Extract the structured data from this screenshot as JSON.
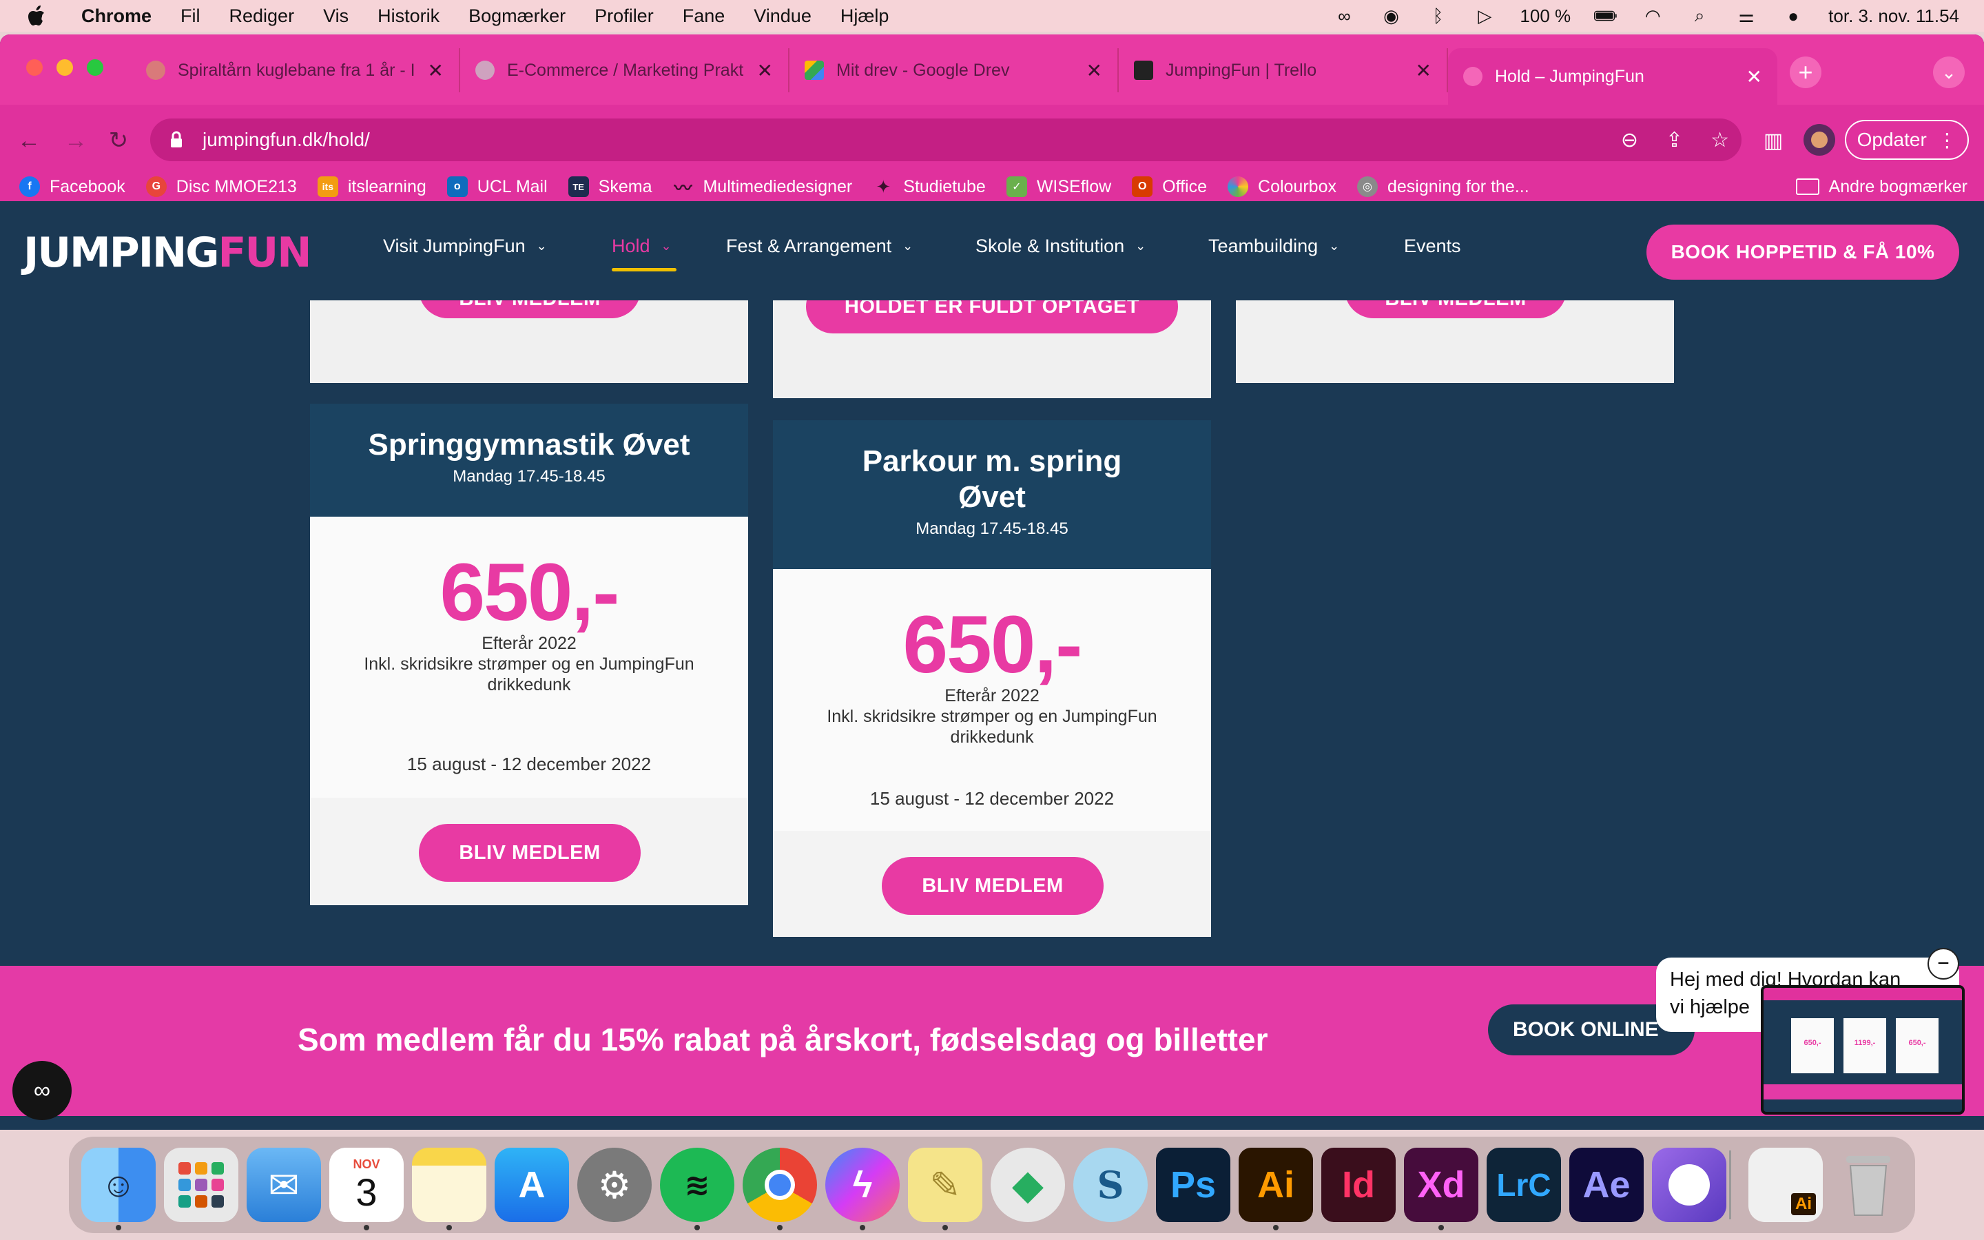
{
  "menubar": {
    "app": "Chrome",
    "items": [
      "Fil",
      "Rediger",
      "Vis",
      "Historik",
      "Bogmærker",
      "Profiler",
      "Fane",
      "Vindue",
      "Hjælp"
    ],
    "battery": "100 %",
    "datetime": "tor. 3. nov.  11.54"
  },
  "tabs": [
    {
      "label": "Spiraltårn kuglebane fra 1 år - I",
      "color": "#d97a7a"
    },
    {
      "label": "E-Commerce / Marketing Prakt",
      "color": "#cfa2bf"
    },
    {
      "label": "Mit drev - Google Drev",
      "color": "#34a853"
    },
    {
      "label": "JumpingFun | Trello",
      "color": "#222222"
    },
    {
      "label": "Hold – JumpingFun",
      "color": "#e83aa3"
    }
  ],
  "toolbar": {
    "url": "jumpingfun.dk/hold/",
    "update_label": "Opdater"
  },
  "bookmarks": [
    {
      "label": "Facebook",
      "icon": "f",
      "color": "#1877f2"
    },
    {
      "label": "Disc MMOE213",
      "icon": "G",
      "color": "#e8453c"
    },
    {
      "label": "itslearning",
      "icon": "its",
      "color": "#f39c12"
    },
    {
      "label": "UCL Mail",
      "icon": "o",
      "color": "#0f6cbd"
    },
    {
      "label": "Skema",
      "icon": "TE",
      "color": "#1d2b4f"
    },
    {
      "label": "Multimediedesigner",
      "icon": "~",
      "color": "#5a1844"
    },
    {
      "label": "Studietube",
      "icon": "✦",
      "color": "#3a1a3a"
    },
    {
      "label": "WISEflow",
      "icon": "✓",
      "color": "#6ab04c"
    },
    {
      "label": "Office",
      "icon": "O",
      "color": "#d83b01"
    },
    {
      "label": "Colourbox",
      "icon": "✿",
      "color": "#e84393"
    },
    {
      "label": "designing for the...",
      "icon": "◎",
      "color": "#8a8a8a"
    }
  ],
  "other_bookmarks": "Andre bogmærker",
  "site": {
    "logo_a": "JUMPING",
    "logo_b": "FUN",
    "nav": [
      "Visit JumpingFun",
      "Hold",
      "Fest & Arrangement",
      "Skole & Institution",
      "Teambuilding",
      "Events"
    ],
    "cta": "BOOK HOPPETID & FÅ 10%"
  },
  "top_row": {
    "left_btn": "BLIV MEDLEM",
    "middle_btn": "HOLDET ER FULDT OPTAGET",
    "right_btn": "BLIV MEDLEM"
  },
  "cards": [
    {
      "title_1": "Springgymnastik Øvet",
      "title_2": "",
      "time": "Mandag 17.45-18.45",
      "price": "650,-",
      "season": "Efterår 2022",
      "incl": "Inkl. skridsikre strømper og en JumpingFun drikkedunk",
      "dates": "15 august - 12 december 2022",
      "button": "BLIV MEDLEM"
    },
    {
      "title_1": "Parkour m. spring",
      "title_2": "Øvet",
      "time": "Mandag 17.45-18.45",
      "price": "650,-",
      "season": "Efterår 2022",
      "incl": "Inkl. skridsikre strømper og en JumpingFun drikkedunk",
      "dates": "15 august - 12 december 2022",
      "button": "BLIV MEDLEM"
    }
  ],
  "promo": {
    "text": "Som medlem får du 15% rabat på årskort, fødselsdag og billetter",
    "button": "BOOK ONLINE"
  },
  "chat": {
    "line1": "Hej med dig! Hvordan kan",
    "line2": "vi hjælpe"
  },
  "thumbnail": {
    "p1": "650,-",
    "p2": "1199,-",
    "p3": "650,-"
  },
  "dock": {
    "calendar_month": "NOV",
    "calendar_day": "3",
    "apps": [
      {
        "name": "finder",
        "label": "",
        "color": "#3d8ef0"
      },
      {
        "name": "launchpad",
        "label": "",
        "color": "#e8e8e8"
      },
      {
        "name": "mail",
        "label": "",
        "color": "#4aa3f0"
      },
      {
        "name": "calendar",
        "label": "",
        "color": "#ffffff"
      },
      {
        "name": "notes",
        "label": "",
        "color": "#fdf6d8"
      },
      {
        "name": "app-store",
        "label": "",
        "color": "#1a8cf0"
      },
      {
        "name": "system-settings",
        "label": "",
        "color": "#8a8a8a"
      },
      {
        "name": "spotify",
        "label": "",
        "color": "#1db954"
      },
      {
        "name": "chrome",
        "label": "",
        "color": "#ffffff"
      },
      {
        "name": "messenger",
        "label": "",
        "color": "#a64bf4"
      },
      {
        "name": "stickies",
        "label": "",
        "color": "#f5e48a"
      },
      {
        "name": "sims",
        "label": "",
        "color": "#d8d8d8"
      },
      {
        "name": "skype-s",
        "label": "",
        "color": "#a8d8f0"
      },
      {
        "name": "photoshop",
        "label": "Ps",
        "color": "#0b1f36"
      },
      {
        "name": "illustrator",
        "label": "Ai",
        "color": "#2a1500"
      },
      {
        "name": "indesign",
        "label": "Id",
        "color": "#3a0e1c"
      },
      {
        "name": "xd",
        "label": "Xd",
        "color": "#460c3c"
      },
      {
        "name": "lightroom-classic",
        "label": "LrC",
        "color": "#0e2438"
      },
      {
        "name": "after-effects",
        "label": "Ae",
        "color": "#0f0b3a"
      },
      {
        "name": "github",
        "label": "",
        "color": "#7a4fd0"
      },
      {
        "name": "recent-illustrator",
        "label": "Ai",
        "color": "#f0f0f0"
      },
      {
        "name": "trash",
        "label": "",
        "color": "#c8c8c8"
      }
    ]
  }
}
